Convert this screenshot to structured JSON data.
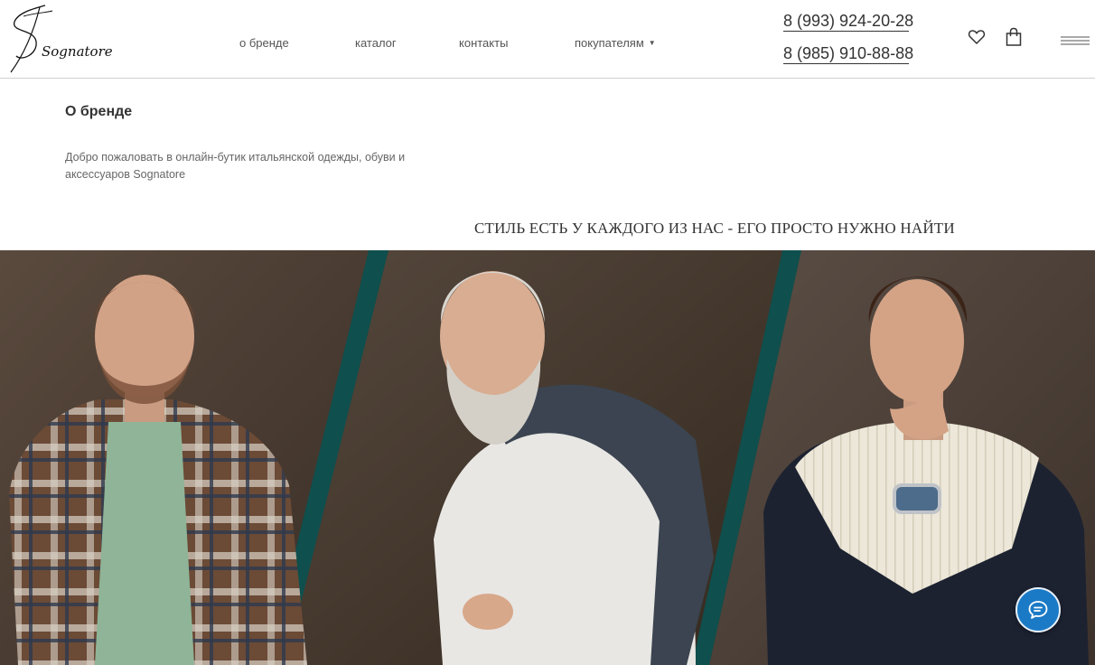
{
  "header": {
    "logo_text": "Sognatore",
    "nav": [
      {
        "label": "о бренде"
      },
      {
        "label": "каталог"
      },
      {
        "label": "контакты"
      },
      {
        "label": "покупателям"
      }
    ],
    "phones": [
      "8 (993) 924-20-28",
      "8 (985) 910-88-88"
    ],
    "icons": [
      "heart-icon",
      "shopping-bag-icon",
      "menu-icon"
    ]
  },
  "intro": {
    "title": "О бренде",
    "text": "Добро пожаловать в онлайн-бутик итальянской одежды, обуви и аксессуаров Sognatore"
  },
  "slogan": "СТИЛЬ ЕСТЬ У КАЖДОГО ИЗ НАС - ЕГО ПРОСТО НУЖНО НАЙТИ",
  "chat": {
    "icon": "chat-icon",
    "color": "#1b7ac6"
  },
  "colors": {
    "accent_teal": "#0f4f4d",
    "chat_blue": "#1b7ac6"
  }
}
